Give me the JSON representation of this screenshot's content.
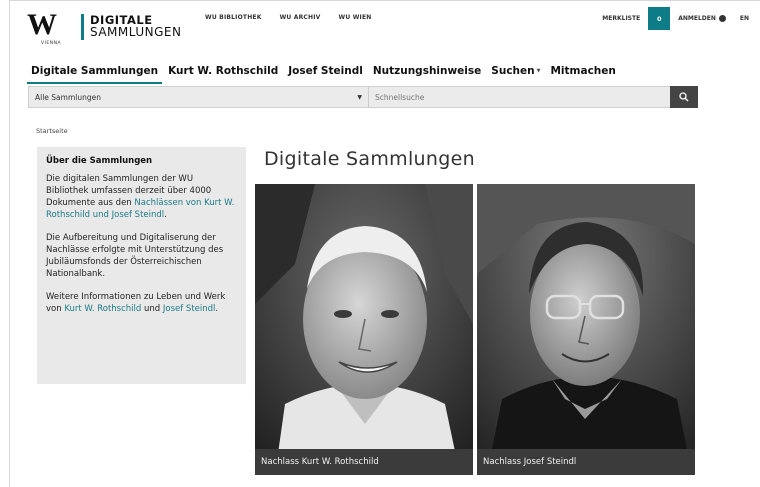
{
  "logo": {
    "line1": "DIGITALE",
    "line2": "SAMMLUNGEN",
    "sub": "VIENNA"
  },
  "toplinks": [
    "WU BIBLIOTHEK",
    "WU ARCHIV",
    "WU WIEN"
  ],
  "userbar": {
    "merkliste": "MERKLISTE",
    "count": "0",
    "login": "ANMELDEN",
    "lang": "EN"
  },
  "nav": [
    "Digitale Sammlungen",
    "Kurt W. Rothschild",
    "Josef Steindl",
    "Nutzungshinweise",
    "Suchen",
    "Mitmachen"
  ],
  "search": {
    "select_value": "Alle Sammlungen",
    "placeholder": "Schnellsuche"
  },
  "breadcrumb": "Startseite",
  "sidebar": {
    "title": "Über die Sammlungen",
    "p1_a": "Die digitalen Sammlungen der WU Bibliothek umfassen derzeit über 4000 Dokumente aus den ",
    "p1_link": "Nachlässen von Kurt W. Rothschild und Josef Steindl",
    "p1_b": ".",
    "p2": "Die Aufbereitung und Digitaliserung der Nachlässe erfolgte mit Unterstützung des Jubiläumsfonds der Österreichischen Nationalbank.",
    "p3_a": "Weitere Informationen zu Leben und Werk von ",
    "p3_link1": "Kurt W. Rothschild",
    "p3_and": " und ",
    "p3_link2": "Josef Steindl",
    "p3_b": "."
  },
  "main": {
    "title": "Digitale Sammlungen",
    "cards": [
      {
        "caption": "Nachlass Kurt W. Rothschild"
      },
      {
        "caption": "Nachlass Josef Steindl"
      }
    ]
  },
  "colors": {
    "accent": "#0e7c86",
    "sidebar_bg": "#e9e9e9"
  }
}
